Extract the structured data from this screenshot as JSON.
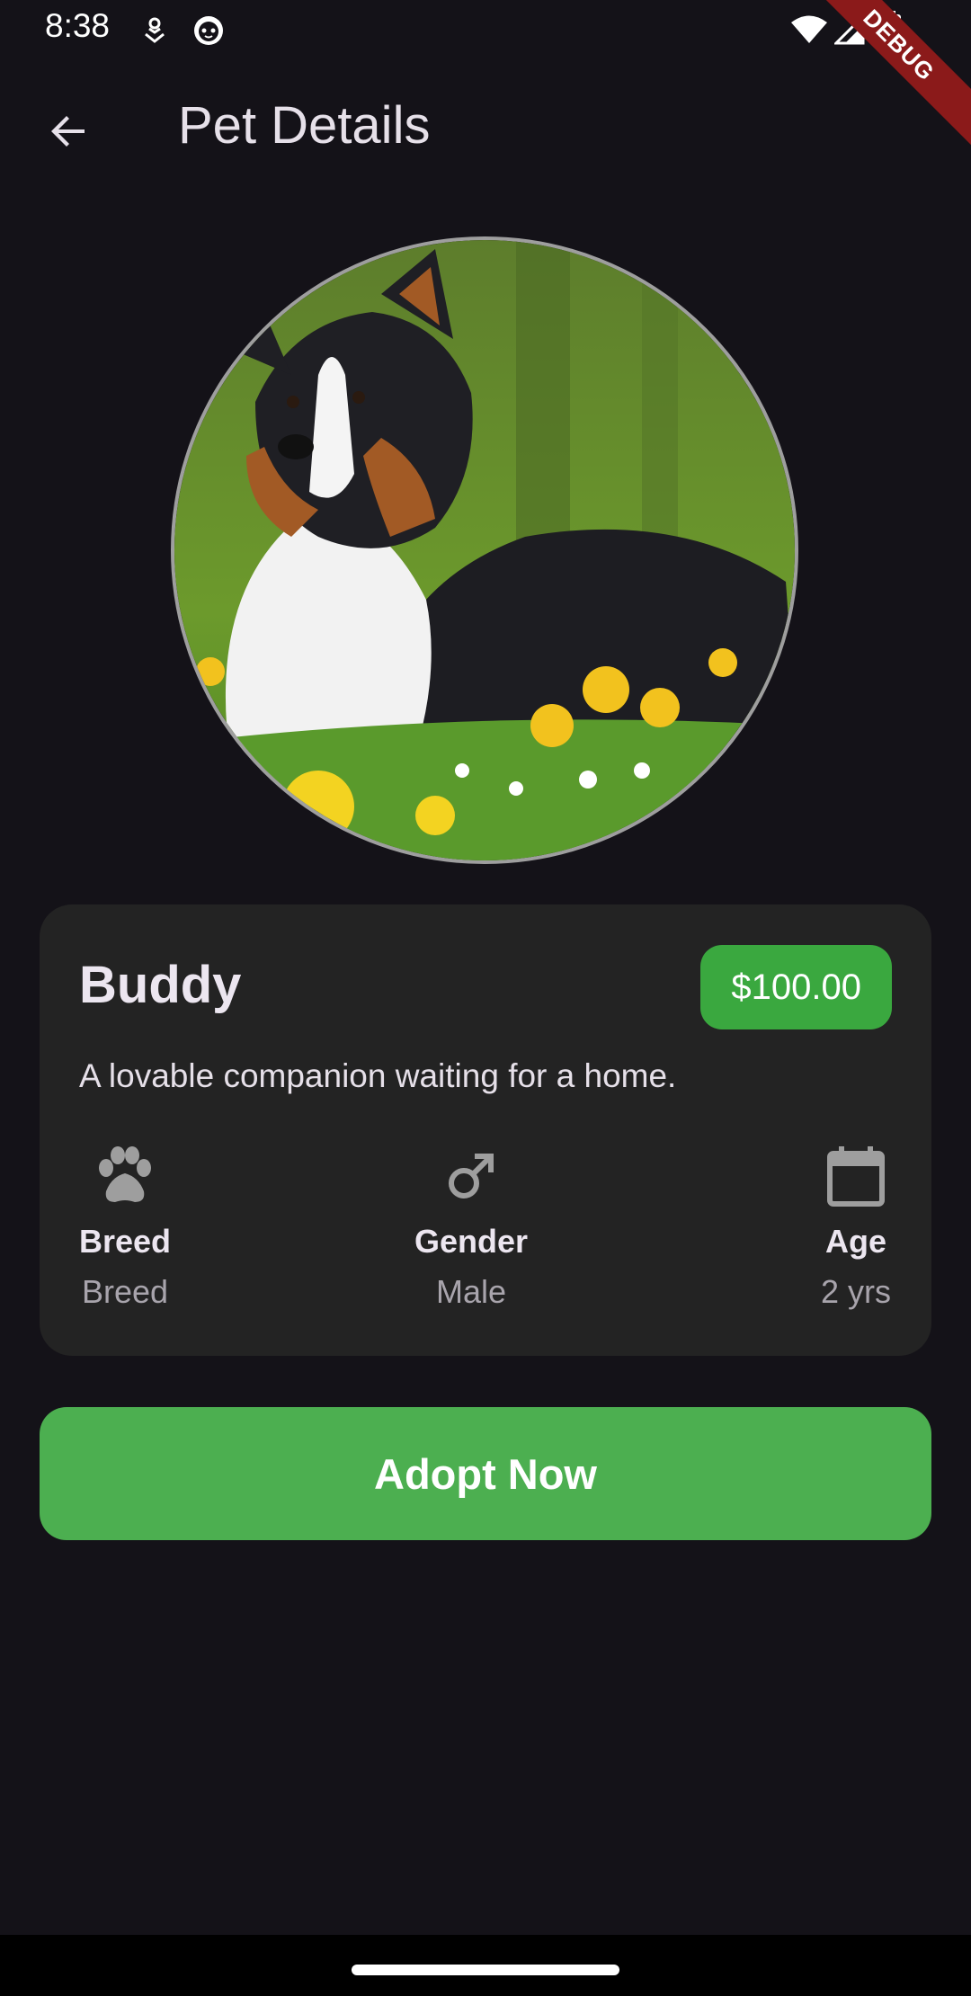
{
  "status_bar": {
    "time": "8:38",
    "icons": [
      "notification-icon",
      "cat-face-icon",
      "wifi-icon",
      "signal-icon",
      "battery-icon"
    ]
  },
  "debug_banner": "DEBUG",
  "app_bar": {
    "back_icon": "arrow-back-icon",
    "title": "Pet Details"
  },
  "pet": {
    "name": "Buddy",
    "price": "$100.00",
    "description": "A lovable companion waiting for a home.",
    "stats": [
      {
        "icon": "paw-icon",
        "label": "Breed",
        "value": "Breed"
      },
      {
        "icon": "male-icon",
        "label": "Gender",
        "value": "Male"
      },
      {
        "icon": "calendar-icon",
        "label": "Age",
        "value": "2 yrs"
      }
    ]
  },
  "actions": {
    "adopt_label": "Adopt Now"
  },
  "colors": {
    "background": "#141218",
    "card": "#232323",
    "accent_green": "#4caf50",
    "price_green": "#3aa83f",
    "icon_grey": "#9e9e9e"
  }
}
